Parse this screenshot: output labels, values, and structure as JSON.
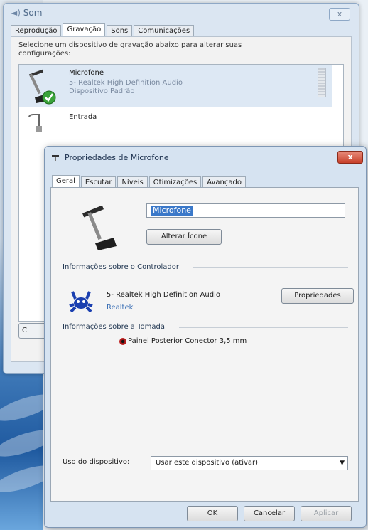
{
  "sound_window": {
    "title": "Som",
    "close_label": "x",
    "tabs": [
      "Reprodução",
      "Gravação",
      "Sons",
      "Comunicações"
    ],
    "active_tab_index": 1,
    "description": "Selecione um dispositivo de gravação abaixo para alterar suas configurações:",
    "devices": [
      {
        "name": "Microfone",
        "driver": "5- Realtek High Definition Audio",
        "status": "Dispositivo Padrão"
      },
      {
        "name": "Entrada"
      }
    ],
    "configure_button_label": "C"
  },
  "properties_dialog": {
    "title": "Propriedades de Microfone",
    "close_label": "x",
    "tabs": [
      "Geral",
      "Escutar",
      "Níveis",
      "Otimizações",
      "Avançado"
    ],
    "active_tab_index": 0,
    "device_name_value": "Microfone",
    "change_icon_label": "Alterar Ícone",
    "controller_section_title": "Informações sobre o Controlador",
    "controller_name": "5- Realtek High Definition Audio",
    "controller_link": "Realtek",
    "properties_button_label": "Propriedades",
    "jack_section_title": "Informações sobre a Tomada",
    "jack_description": "Painel Posterior Conector 3,5 mm",
    "jack_color": "#c42020",
    "device_usage_label": "Uso do dispositivo:",
    "device_usage_value": "Usar este dispositivo (ativar)",
    "ok_label": "OK",
    "cancel_label": "Cancelar",
    "apply_label": "Aplicar"
  }
}
